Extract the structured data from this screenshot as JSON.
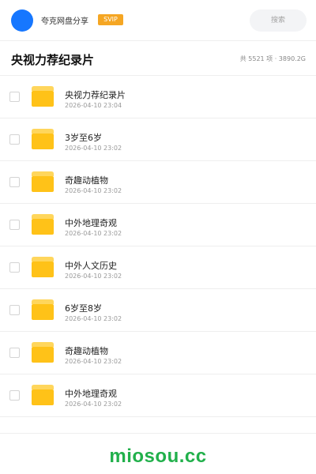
{
  "header": {
    "username": "夸克网盘分享",
    "badge": "SVIP",
    "search_placeholder": "搜索",
    "accent_color": "#1677ff",
    "badge_color": "#f5a623"
  },
  "title_bar": {
    "title": "央视力荐纪录片",
    "stats": "共 5521 项 · 3890.2G"
  },
  "items": [
    {
      "name": "央视力荐纪录片",
      "date": "2026-04-10 23:04",
      "icon": "folder-icon"
    },
    {
      "name": "3岁至6岁",
      "date": "2026-04-10 23:02",
      "icon": "folder-icon"
    },
    {
      "name": "奇趣动植物",
      "date": "2026-04-10 23:02",
      "icon": "folder-icon"
    },
    {
      "name": "中外地理奇观",
      "date": "2026-04-10 23:02",
      "icon": "folder-icon"
    },
    {
      "name": "中外人文历史",
      "date": "2026-04-10 23:02",
      "icon": "folder-icon"
    },
    {
      "name": "6岁至8岁",
      "date": "2026-04-10 23:02",
      "icon": "folder-icon"
    },
    {
      "name": "奇趣动植物",
      "date": "2026-04-10 23:02",
      "icon": "folder-icon"
    },
    {
      "name": "中外地理奇观",
      "date": "2026-04-10 23:02",
      "icon": "folder-icon"
    }
  ],
  "footer": {
    "watermark": "miosou.cc",
    "watermark_color": "#21b04b"
  }
}
